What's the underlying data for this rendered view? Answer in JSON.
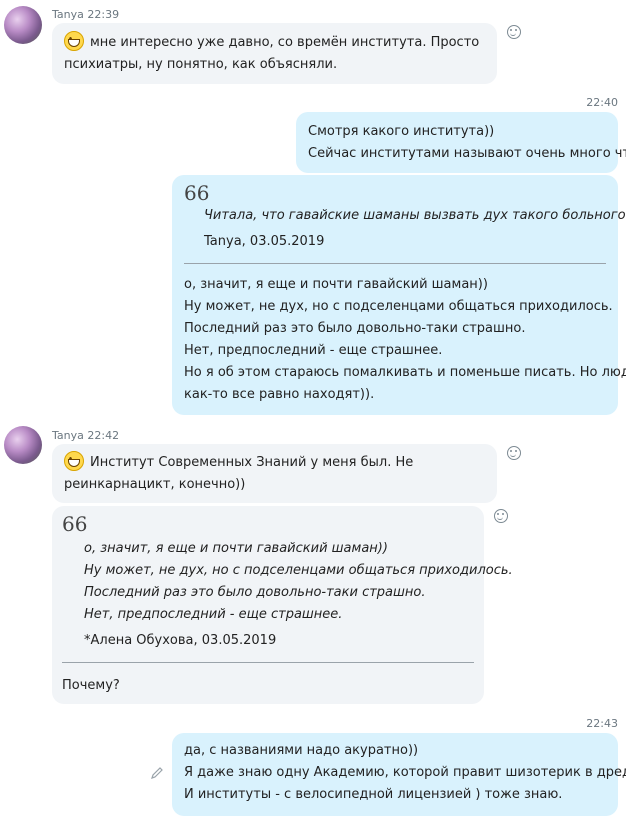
{
  "messages": {
    "m1": {
      "sender": "Tanya",
      "time": "22:39",
      "lines": [
        "мне интересно уже давно, со времён института. Просто",
        "психиатры, ну понятно, как объясняли."
      ]
    },
    "time2": "22:40",
    "m2": {
      "lines": [
        "Смотря какого института))",
        "Сейчас институтами называют очень много что"
      ]
    },
    "m3": {
      "quote_mark": "66",
      "quote": "Читала, что гавайские шаманы вызвать дух такого больного",
      "quote_attrib": "Tanya, 03.05.2019",
      "lines": [
        "о, значит, я еще и почти гавайский шаман))",
        "Ну может, не дух, но с подселенцами общаться приходилось.",
        "Последний раз это было довольно-таки страшно.",
        "Нет, предпоследний - еще страшнее.",
        "Но я об этом стараюсь помалкивать и поменьше писать. Но люди",
        "как-то все равно находят))."
      ]
    },
    "m4": {
      "sender": "Tanya",
      "time": "22:42",
      "lines": [
        "Институт Современных Знаний у меня был. Не",
        "реинкарнацикт, конечно))"
      ]
    },
    "m5": {
      "quote_mark": "66",
      "quote_lines": [
        "о, значит, я еще и почти гавайский шаман))",
        "Ну может, не дух, но с подселенцами общаться приходилось.",
        "Последний раз это было довольно-таки страшно.",
        "Нет, предпоследний - еще страшнее."
      ],
      "quote_attrib": "*Алена Обухова, 03.05.2019",
      "reply": "Почему?"
    },
    "time6": "22:43",
    "m6": {
      "lines": [
        "да, с названиями надо акуратно))",
        "Я даже знаю одну Академию, которой правит шизотерик в дредах)",
        "И институты - с велосипедной лицензией ) тоже знаю."
      ]
    }
  }
}
